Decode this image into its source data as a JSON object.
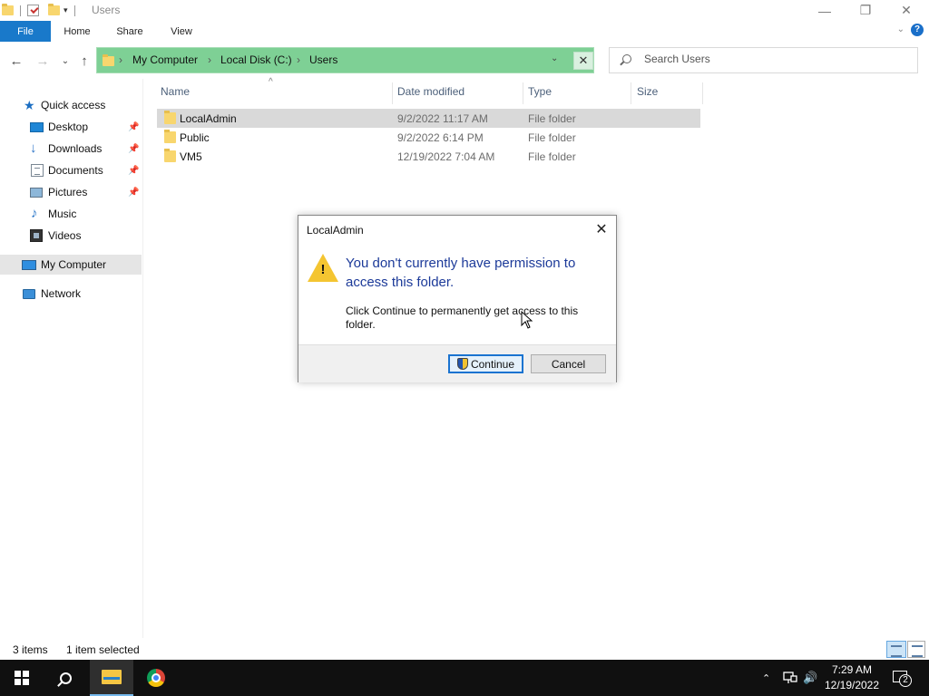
{
  "window": {
    "title": "Users",
    "controls": {
      "minimize": "—",
      "restore": "❐",
      "close": "✕"
    }
  },
  "ribbon": {
    "tabs": [
      "File",
      "Home",
      "Share",
      "View"
    ],
    "chevron": "⌄",
    "help": "?"
  },
  "nav": {
    "back": "←",
    "forward": "→",
    "recent": "⌄",
    "up": "↑",
    "breadcrumbs": [
      "My Computer",
      "Local Disk (C:)",
      "Users"
    ],
    "breadcrumb_sep": "›",
    "address_dropdown": "⌄",
    "address_clear": "✕",
    "search_placeholder": "Search Users"
  },
  "sidebar": {
    "items": [
      {
        "label": "Quick access",
        "icon": "star-icon"
      },
      {
        "label": "Desktop",
        "icon": "desktop-icon",
        "pinned": true
      },
      {
        "label": "Downloads",
        "icon": "download-icon",
        "pinned": true
      },
      {
        "label": "Documents",
        "icon": "documents-icon",
        "pinned": true
      },
      {
        "label": "Pictures",
        "icon": "pictures-icon",
        "pinned": true
      },
      {
        "label": "Music",
        "icon": "music-icon"
      },
      {
        "label": "Videos",
        "icon": "videos-icon"
      },
      {
        "label": "My Computer",
        "icon": "computer-icon",
        "selected": true
      },
      {
        "label": "Network",
        "icon": "network-icon"
      }
    ],
    "pin_glyph": "📌"
  },
  "file_list": {
    "columns": [
      "Name",
      "Date modified",
      "Type",
      "Size"
    ],
    "sort_indicator": "^",
    "rows": [
      {
        "name": "LocalAdmin",
        "date": "9/2/2022 11:17 AM",
        "type": "File folder",
        "selected": true
      },
      {
        "name": "Public",
        "date": "9/2/2022 6:14 PM",
        "type": "File folder"
      },
      {
        "name": "VM5",
        "date": "12/19/2022 7:04 AM",
        "type": "File folder"
      }
    ]
  },
  "status": {
    "item_count": "3 items",
    "selection": "1 item selected"
  },
  "dialog": {
    "title": "LocalAdmin",
    "close": "✕",
    "warning_mark": "!",
    "heading": "You don't currently have permission to access this folder.",
    "body": "Click Continue to permanently get access to this folder.",
    "continue_label": "Continue",
    "cancel_label": "Cancel"
  },
  "taskbar": {
    "time": "7:29 AM",
    "date": "12/19/2022",
    "notification_count": "2",
    "tray_chevron": "⌃",
    "volume": "🔊"
  },
  "colors": {
    "accent": "#1979ca",
    "address_bar": "#7ed095",
    "dialog_heading": "#1c3a99",
    "warning": "#f4c531",
    "taskbar": "#101010"
  }
}
